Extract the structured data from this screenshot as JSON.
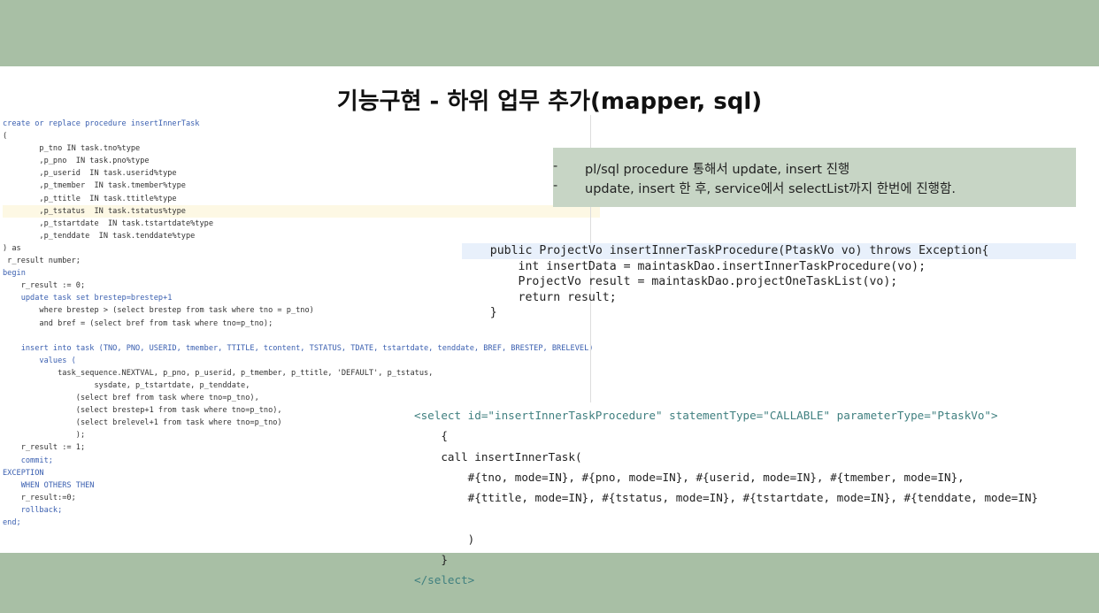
{
  "title": "기능구현 - 하위 업무 추가(mapper, sql)",
  "notes": [
    "pl/sql procedure 통해서 update, insert 진행",
    "update, insert 한 후, service에서 selectList까지 한번에 진행함."
  ],
  "note_bullet": "-",
  "sql_lines": [
    "create or replace procedure insertInnerTask",
    "(",
    "        p_tno IN task.tno%type",
    "        ,p_pno  IN task.pno%type",
    "        ,p_userid  IN task.userid%type",
    "        ,p_tmember  IN task.tmember%type",
    "        ,p_ttitle  IN task.ttitle%type",
    "        ,p_tstatus  IN task.tstatus%type",
    "        ,p_tstartdate  IN task.tstartdate%type",
    "        ,p_tenddate  IN task.tenddate%type",
    ") as",
    " r_result number;",
    "begin",
    "    r_result := 0;",
    "    update task set brestep=brestep+1",
    "        where brestep > (select brestep from task where tno = p_tno)",
    "        and bref = (select bref from task where tno=p_tno);",
    "",
    "    insert into task (TNO, PNO, USERID, tmember, TTITLE, tcontent, TSTATUS, TDATE, tstartdate, tenddate, BREF, BRESTEP, BRELEVEL)",
    "        values (",
    "            task_sequence.NEXTVAL, p_pno, p_userid, p_tmember, p_ttitle, 'DEFAULT', p_tstatus,",
    "                    sysdate, p_tstartdate, p_tenddate,",
    "                (select bref from task where tno=p_tno),",
    "                (select brestep+1 from task where tno=p_tno),",
    "                (select brelevel+1 from task where tno=p_tno)",
    "                );",
    "    r_result := 1;",
    "    commit;",
    "EXCEPTION",
    "    WHEN OTHERS THEN",
    "    r_result:=0;",
    "    rollback;",
    "end;"
  ],
  "sql_highlight_line": 7,
  "java_lines": [
    "    public ProjectVo insertInnerTaskProcedure(PtaskVo vo) throws Exception{",
    "        int insertData = maintaskDao.insertInnerTaskProcedure(vo);",
    "        ProjectVo result = maintaskDao.projectOneTaskList(vo);",
    "        return result;",
    "    }"
  ],
  "java_highlight_line": 0,
  "xml_lines": [
    "<select id=\"insertInnerTaskProcedure\" statementType=\"CALLABLE\" parameterType=\"PtaskVo\">",
    "    {",
    "    call insertInnerTask(",
    "        #{tno, mode=IN}, #{pno, mode=IN}, #{userid, mode=IN}, #{tmember, mode=IN},",
    "        #{ttitle, mode=IN}, #{tstatus, mode=IN}, #{tstartdate, mode=IN}, #{tenddate, mode=IN}",
    "",
    "        )",
    "    }",
    "</select>"
  ],
  "colors": {
    "band": "#a8bfa5",
    "note_bg": "#c7d5c5",
    "keyword": "#3a5fb0"
  }
}
